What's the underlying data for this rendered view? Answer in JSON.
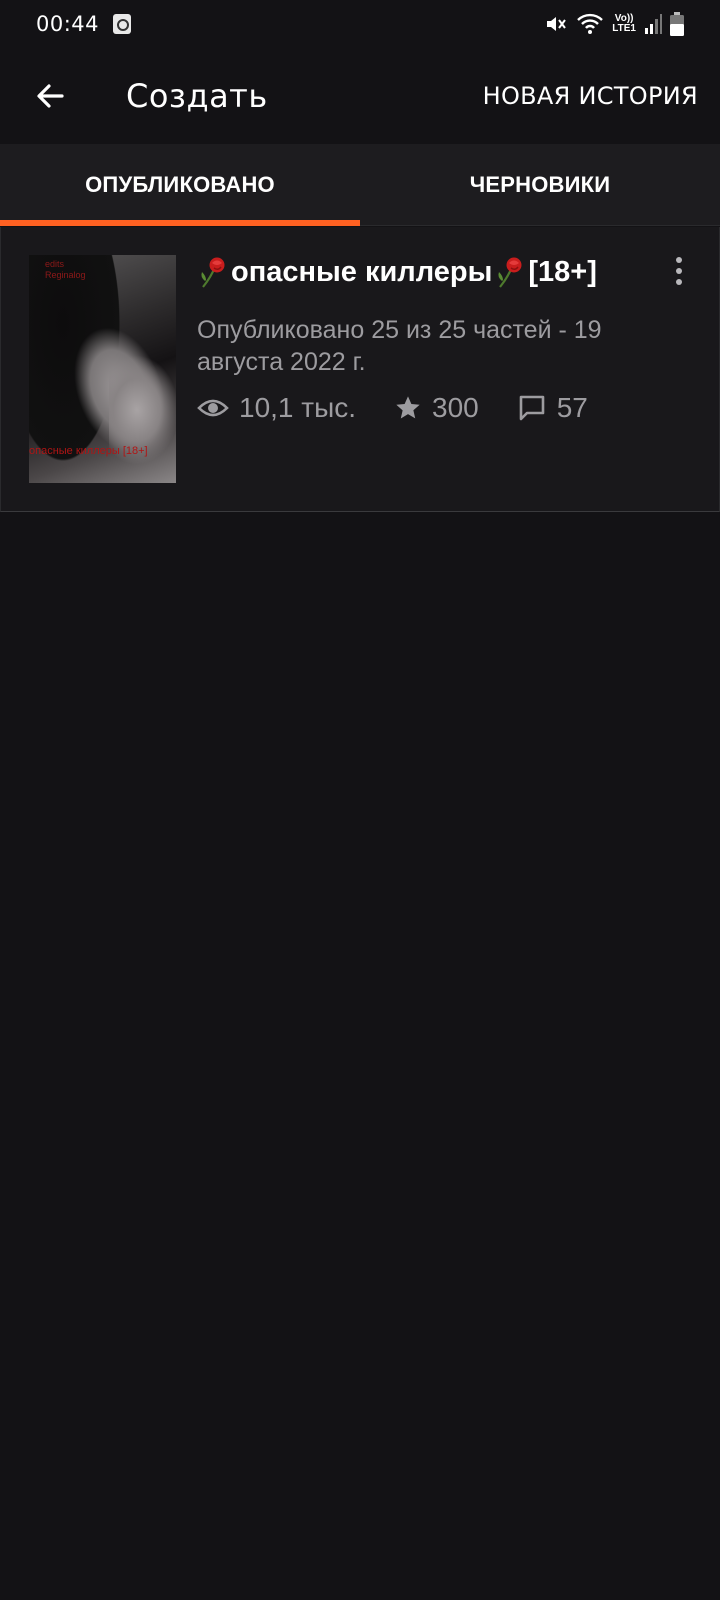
{
  "status_bar": {
    "time": "00:44",
    "lte_label_top": "Vo))",
    "lte_label_bottom": "LTE1"
  },
  "app_bar": {
    "title": "Создать",
    "new_story_label": "НОВАЯ ИСТОРИЯ"
  },
  "tabs": [
    {
      "label": "ОПУБЛИКОВАНО",
      "active": true
    },
    {
      "label": "ЧЕРНОВИКИ",
      "active": false
    }
  ],
  "story": {
    "title": "опасные киллеры",
    "title_suffix": "[18+]",
    "meta": "Опубликовано 25 из 25 частей - 19 августа 2022 г.",
    "views": "10,1 тыс.",
    "votes": "300",
    "comments": "57",
    "cover_top_text": "edits\nReginalog",
    "cover_bottom_text": "опасные киллеры [18+]"
  },
  "colors": {
    "accent": "#ff6122",
    "background": "#131215",
    "card": "#19181b",
    "secondary_text": "#9d9ca0"
  }
}
